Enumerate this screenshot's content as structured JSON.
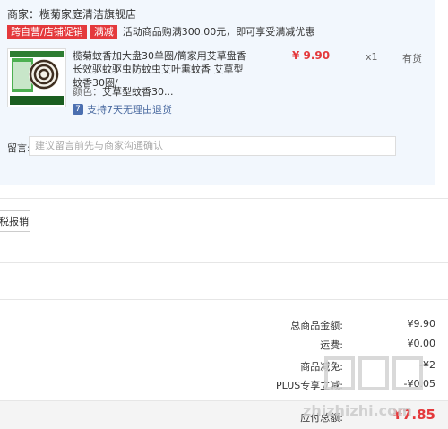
{
  "seller": {
    "label": "商家：",
    "name": "榄菊家庭清洁旗舰店"
  },
  "promo": {
    "tags": [
      "跨自营/店铺促销",
      "满减"
    ],
    "text": "活动商品购满300.00元，即可享受满减优惠"
  },
  "product": {
    "title": "榄菊蚊香加大盘30单圈/筒家用艾草盘香长效驱蚊驱虫防蚊虫艾叶熏蚊香 艾草型蚊香30圈/",
    "price": "¥ 9.90",
    "qty": "x1",
    "stock": "有货",
    "color_label": "颜色：",
    "color_value": "艾草型蚊香30...",
    "return_text": "支持7天无理由退货",
    "return_icon": "7"
  },
  "note": {
    "label": "留言:",
    "placeholder": "建议留言前先与商家沟通确认"
  },
  "invoice": {
    "label": "税报销"
  },
  "summary": [
    {
      "label": "总商品金额:",
      "value": "¥9.90"
    },
    {
      "label": "运费:",
      "value": "¥0.00"
    },
    {
      "label": "商品减免:",
      "value": "-¥2"
    },
    {
      "label": "PLUS专享立减:",
      "value": "-¥0.05"
    }
  ],
  "payable": {
    "label": "应付总额:",
    "value": "¥7.85"
  },
  "watermark": {
    "text": "zhizhizhi.com"
  },
  "colors": {
    "accent": "#e4393c",
    "panel": "#f2f7fd",
    "link": "#4a6aa0"
  }
}
